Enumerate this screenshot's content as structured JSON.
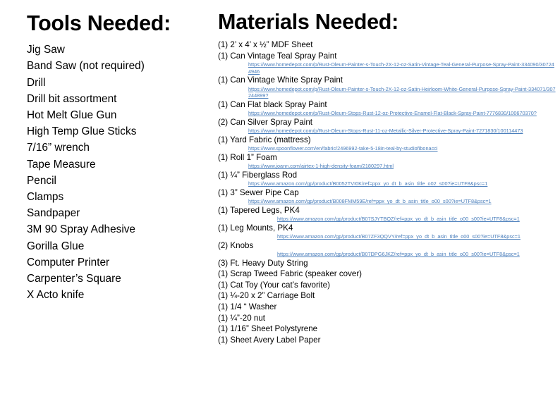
{
  "tools": {
    "title": "Tools Needed:",
    "items": [
      "Jig Saw",
      "Band Saw (not required)",
      "Drill",
      "Drill bit assortment",
      "Hot Melt Glue Gun",
      "High Temp Glue Sticks",
      "7/16” wrench",
      "Tape Measure",
      "Pencil",
      "Clamps",
      "Sandpaper",
      "3M 90 Spray Adhesive",
      "Gorilla Glue",
      "Computer Printer",
      "Carpenter’s Square",
      "X Acto knife"
    ]
  },
  "materials": {
    "title": "Materials Needed:",
    "link_color": "#4a7ebb",
    "items": [
      {
        "label": "(1) 2’ x 4’ x ½” MDF Sheet",
        "link": null,
        "indent": "normal"
      },
      {
        "label": "(1) Can Vintage Teal Spray Paint",
        "link": "https://www.homedepot.com/p/Rust-Oleum-Painter-s-Touch-2X-12-oz-Satin-Vintage-Teal-General-Purpose-Spray-Paint-334090/307244946",
        "indent": "normal"
      },
      {
        "label": "(1) Can Vintage White Spray Paint",
        "link": "https://www.homedepot.com/p/Rust-Oleum-Painter-s-Touch-2X-12-oz-Satin-Heirloom-White-General-Purpose-Spray-Paint-334071/307244899?",
        "indent": "normal"
      },
      {
        "label": "(1)  Can Flat black Spray Paint",
        "link": "https://www.homedepot.com/p/Rust-Oleum-Stops-Rust-12-oz-Protective-Enamel-Flat-Black-Spray-Paint-7776830/100670370?",
        "indent": "normal"
      },
      {
        "label": "(2) Can Silver Spray Paint",
        "link": "https://www.homedepot.com/p/Rust-Oleum-Stops-Rust-11-oz-Metallic-Silver-Protective-Spray-Paint-7271830/100114473",
        "indent": "normal"
      },
      {
        "label": "(1) Yard Fabric (mattress)",
        "link": "https://www.spoonflower.com/en/fabric/2496992-take-5-18in-teal-by-studiofibonacci",
        "indent": "normal"
      },
      {
        "label": "(1) Roll 1” Foam",
        "link": "https://www.joann.com/airtex-1-high-density-foam/2180297.html",
        "indent": "normal"
      },
      {
        "label": "(1) ¼” Fiberglass Rod",
        "link": "https://www.amazon.com/gp/product/B0052TVI0K/ref=ppx_yo_dt_b_asin_title_o02_s00?ie=UTF8&psc=1",
        "indent": "normal"
      },
      {
        "label": "(1)  3” Sewer Pipe Cap",
        "link": "https://www.amazon.com/gp/product/B008FMM59E/ref=ppx_yo_dt_b_asin_title_o00_s00?ie=UTF8&psc=1",
        "indent": "normal"
      },
      {
        "label": "(1) Tapered Legs, PK4",
        "link": "https://www.amazon.com/gp/product/B07SJYTBQZ/ref=ppx_yo_dt_b_asin_title_o00_s00?ie=UTF8&psc=1",
        "indent": "deep"
      },
      {
        "label": "(1) Leg Mounts, PK4",
        "link": "https://www.amazon.com/gp/product/B07ZF3QQVY/ref=ppx_yo_dt_b_asin_title_o00_s00?ie=UTF8&psc=1",
        "indent": "deep"
      },
      {
        "label": "(2) Knobs",
        "link": "https://www.amazon.com/gp/product/B07DPG6JKZ/ref=ppx_yo_dt_b_asin_title_o00_s00?ie=UTF8&psc=1",
        "indent": "deep"
      },
      {
        "label": "(3) Ft. Heavy Duty String",
        "link": null,
        "indent": "normal"
      },
      {
        "label": "(1) Scrap Tweed Fabric (speaker cover)",
        "link": null,
        "indent": "normal"
      },
      {
        "label": "(1) Cat Toy (Your cat’s favorite)",
        "link": null,
        "indent": "normal"
      },
      {
        "label": "(1) ¼-20 x 2” Carriage Bolt",
        "link": null,
        "indent": "normal"
      },
      {
        "label": "(1) 1/4 “ Washer",
        "link": null,
        "indent": "normal"
      },
      {
        "label": "(1)  ¼”-20 nut",
        "link": null,
        "indent": "normal"
      },
      {
        "label": "(1) 1/16” Sheet Polystyrene",
        "link": null,
        "indent": "normal"
      },
      {
        "label": "(1) Sheet Avery Label Paper",
        "link": null,
        "indent": "normal"
      }
    ]
  }
}
